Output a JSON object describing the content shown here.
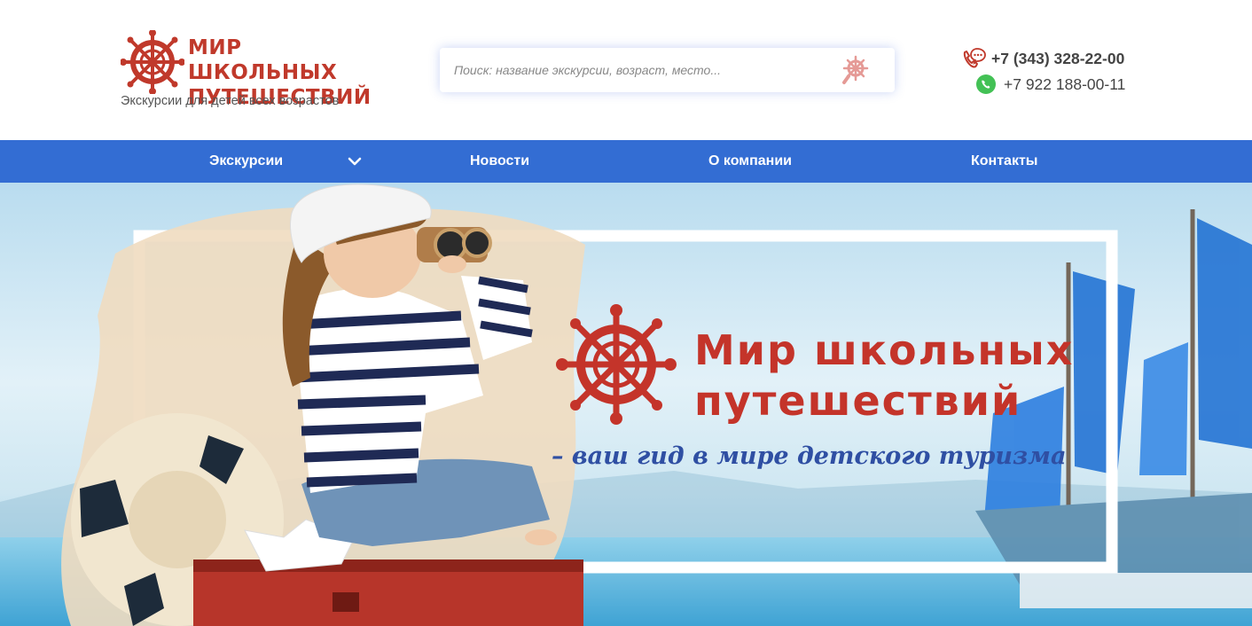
{
  "header": {
    "logo": {
      "title_line1": "МИР ШКОЛЬНЫХ",
      "title_line2": "ПУТЕШЕСТВИЙ",
      "tagline": "Экскурсии для детей всех возрастов",
      "icon": "ship-wheel-icon"
    },
    "search": {
      "placeholder": "Поиск: название экскурсии, возраст, место...",
      "value": "",
      "icon": "ship-wheel-search-icon"
    },
    "contacts": {
      "phone_main": "+7 (343) 328-22-00",
      "phone_main_icon": "phone-chat-icon",
      "phone_whatsapp": "+7 922 188-00-11",
      "phone_whatsapp_icon": "whatsapp-icon"
    }
  },
  "nav": {
    "items": [
      {
        "label": "Экскурсии",
        "has_dropdown": true
      },
      {
        "label": "Новости"
      },
      {
        "label": "О компании"
      },
      {
        "label": "Контакты"
      }
    ]
  },
  "hero": {
    "title_line1": "Мир школьных",
    "title_line2": "путешествий",
    "subtitle": "– ваш гид в мире детского туризма",
    "icon": "ship-wheel-icon"
  },
  "colors": {
    "brand_red": "#c0392b",
    "nav_blue": "#336dd3",
    "subtitle_blue": "#2f4fa3",
    "whatsapp_green": "#43c155"
  }
}
